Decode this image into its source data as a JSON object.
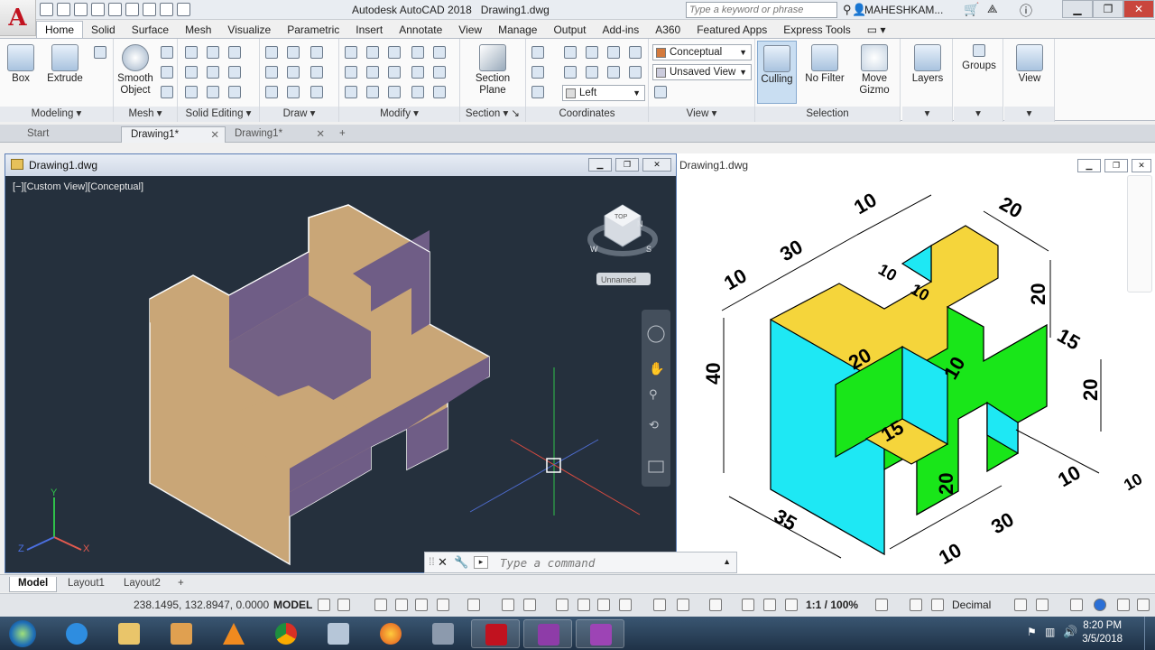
{
  "app": {
    "title": "Autodesk AutoCAD 2018",
    "document": "Drawing1.dwg",
    "search_placeholder": "Type a keyword or phrase",
    "user": "MAHESHKAM..."
  },
  "ribbon_tabs": [
    "Home",
    "Solid",
    "Surface",
    "Mesh",
    "Visualize",
    "Parametric",
    "Insert",
    "Annotate",
    "View",
    "Manage",
    "Output",
    "Add-ins",
    "A360",
    "Featured Apps",
    "Express Tools"
  ],
  "ribbon": {
    "modeling": {
      "label": "Modeling",
      "box": "Box",
      "extrude": "Extrude"
    },
    "mesh": {
      "label": "Mesh",
      "smooth_object": "Smooth Object"
    },
    "solid_editing": {
      "label": "Solid Editing"
    },
    "draw": {
      "label": "Draw"
    },
    "modify": {
      "label": "Modify"
    },
    "section": {
      "label": "Section",
      "section_plane": "Section Plane"
    },
    "coordinates": {
      "label": "Coordinates",
      "ucs_dropdown": "Left"
    },
    "view": {
      "label": "View",
      "visual_style": "Conceptual",
      "saved_view": "Unsaved View"
    },
    "selection": {
      "label": "Selection",
      "culling": "Culling",
      "no_filter": "No Filter",
      "move_gizmo": "Move Gizmo"
    },
    "layers": {
      "label": "Layers"
    },
    "groups": {
      "label": "Groups"
    },
    "view_panel": {
      "label": "View"
    }
  },
  "doc_tabs": {
    "start": "Start",
    "tab1": "Drawing1*",
    "tab2": "Drawing1*"
  },
  "viewport_left": {
    "title": "Drawing1.dwg",
    "label": "[−][Custom View][Conceptual]",
    "viewcube_caption": "Unnamed",
    "viewcube_face": "TOP",
    "compass": {
      "s": "S",
      "w": "W",
      "n": "N"
    },
    "ucs": {
      "x": "X",
      "y": "Y",
      "z": "Z"
    }
  },
  "viewport_right": {
    "title": "Drawing1.dwg",
    "dimensions": [
      "10",
      "20",
      "30",
      "10",
      "20",
      "10",
      "10",
      "40",
      "20",
      "15",
      "10",
      "20",
      "20",
      "15",
      "10",
      "10",
      "35",
      "30",
      "10"
    ]
  },
  "command_line": {
    "placeholder": "Type a command"
  },
  "layout_tabs": [
    "Model",
    "Layout1",
    "Layout2"
  ],
  "status": {
    "coords": "238.1495, 132.8947, 0.0000",
    "mode": "MODEL",
    "scale": "1:1 / 100%",
    "units": "Decimal"
  },
  "taskbar": {
    "time": "8:20 PM",
    "date": "3/5/2018"
  },
  "colors": {
    "face_top": "#c9a677",
    "face_side": "#6f5d86",
    "bg_dark": "#25303d",
    "iso_yellow": "#f5d53b",
    "iso_green": "#19e619",
    "iso_cyan": "#1ee8f4"
  }
}
